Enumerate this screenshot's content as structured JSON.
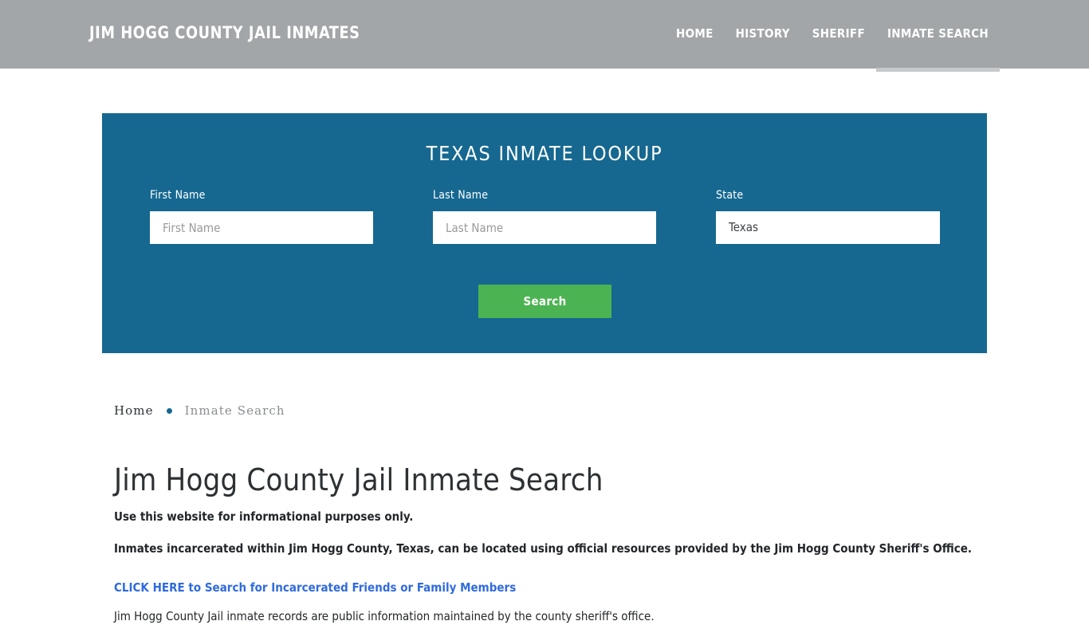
{
  "header": {
    "brand": "Jim Hogg County Jail Inmates",
    "nav": [
      {
        "label": "Home",
        "active": false
      },
      {
        "label": "History",
        "active": false
      },
      {
        "label": "Sheriff",
        "active": false
      },
      {
        "label": "Inmate Search",
        "active": true
      }
    ]
  },
  "lookup": {
    "title": "Texas Inmate Lookup",
    "fields": {
      "first": {
        "label": "First Name",
        "placeholder": "First Name",
        "value": ""
      },
      "last": {
        "label": "Last Name",
        "placeholder": "Last Name",
        "value": ""
      },
      "state": {
        "label": "State",
        "value": "Texas"
      }
    },
    "submit_label": "Search"
  },
  "breadcrumb": {
    "home": "Home",
    "separator": "•",
    "current": "Inmate Search"
  },
  "main": {
    "title": "Jim Hogg County Jail Inmate Search",
    "paragraph_1": "Use this website for informational purposes only.",
    "paragraph_2": "Inmates incarcerated within Jim Hogg County, Texas, can be located using official resources provided by the Jim Hogg County Sheriff's Office.",
    "link_text": "CLICK HERE to Search for Incarcerated Friends or Family Members",
    "paragraph_3": "Jim Hogg County Jail inmate records are public information maintained by the county sheriff's office."
  },
  "colors": {
    "header_bg": "#a2a6a9",
    "panel_bg": "#166890",
    "accent_green": "#4cb352",
    "link_blue": "#2f6bdd"
  }
}
